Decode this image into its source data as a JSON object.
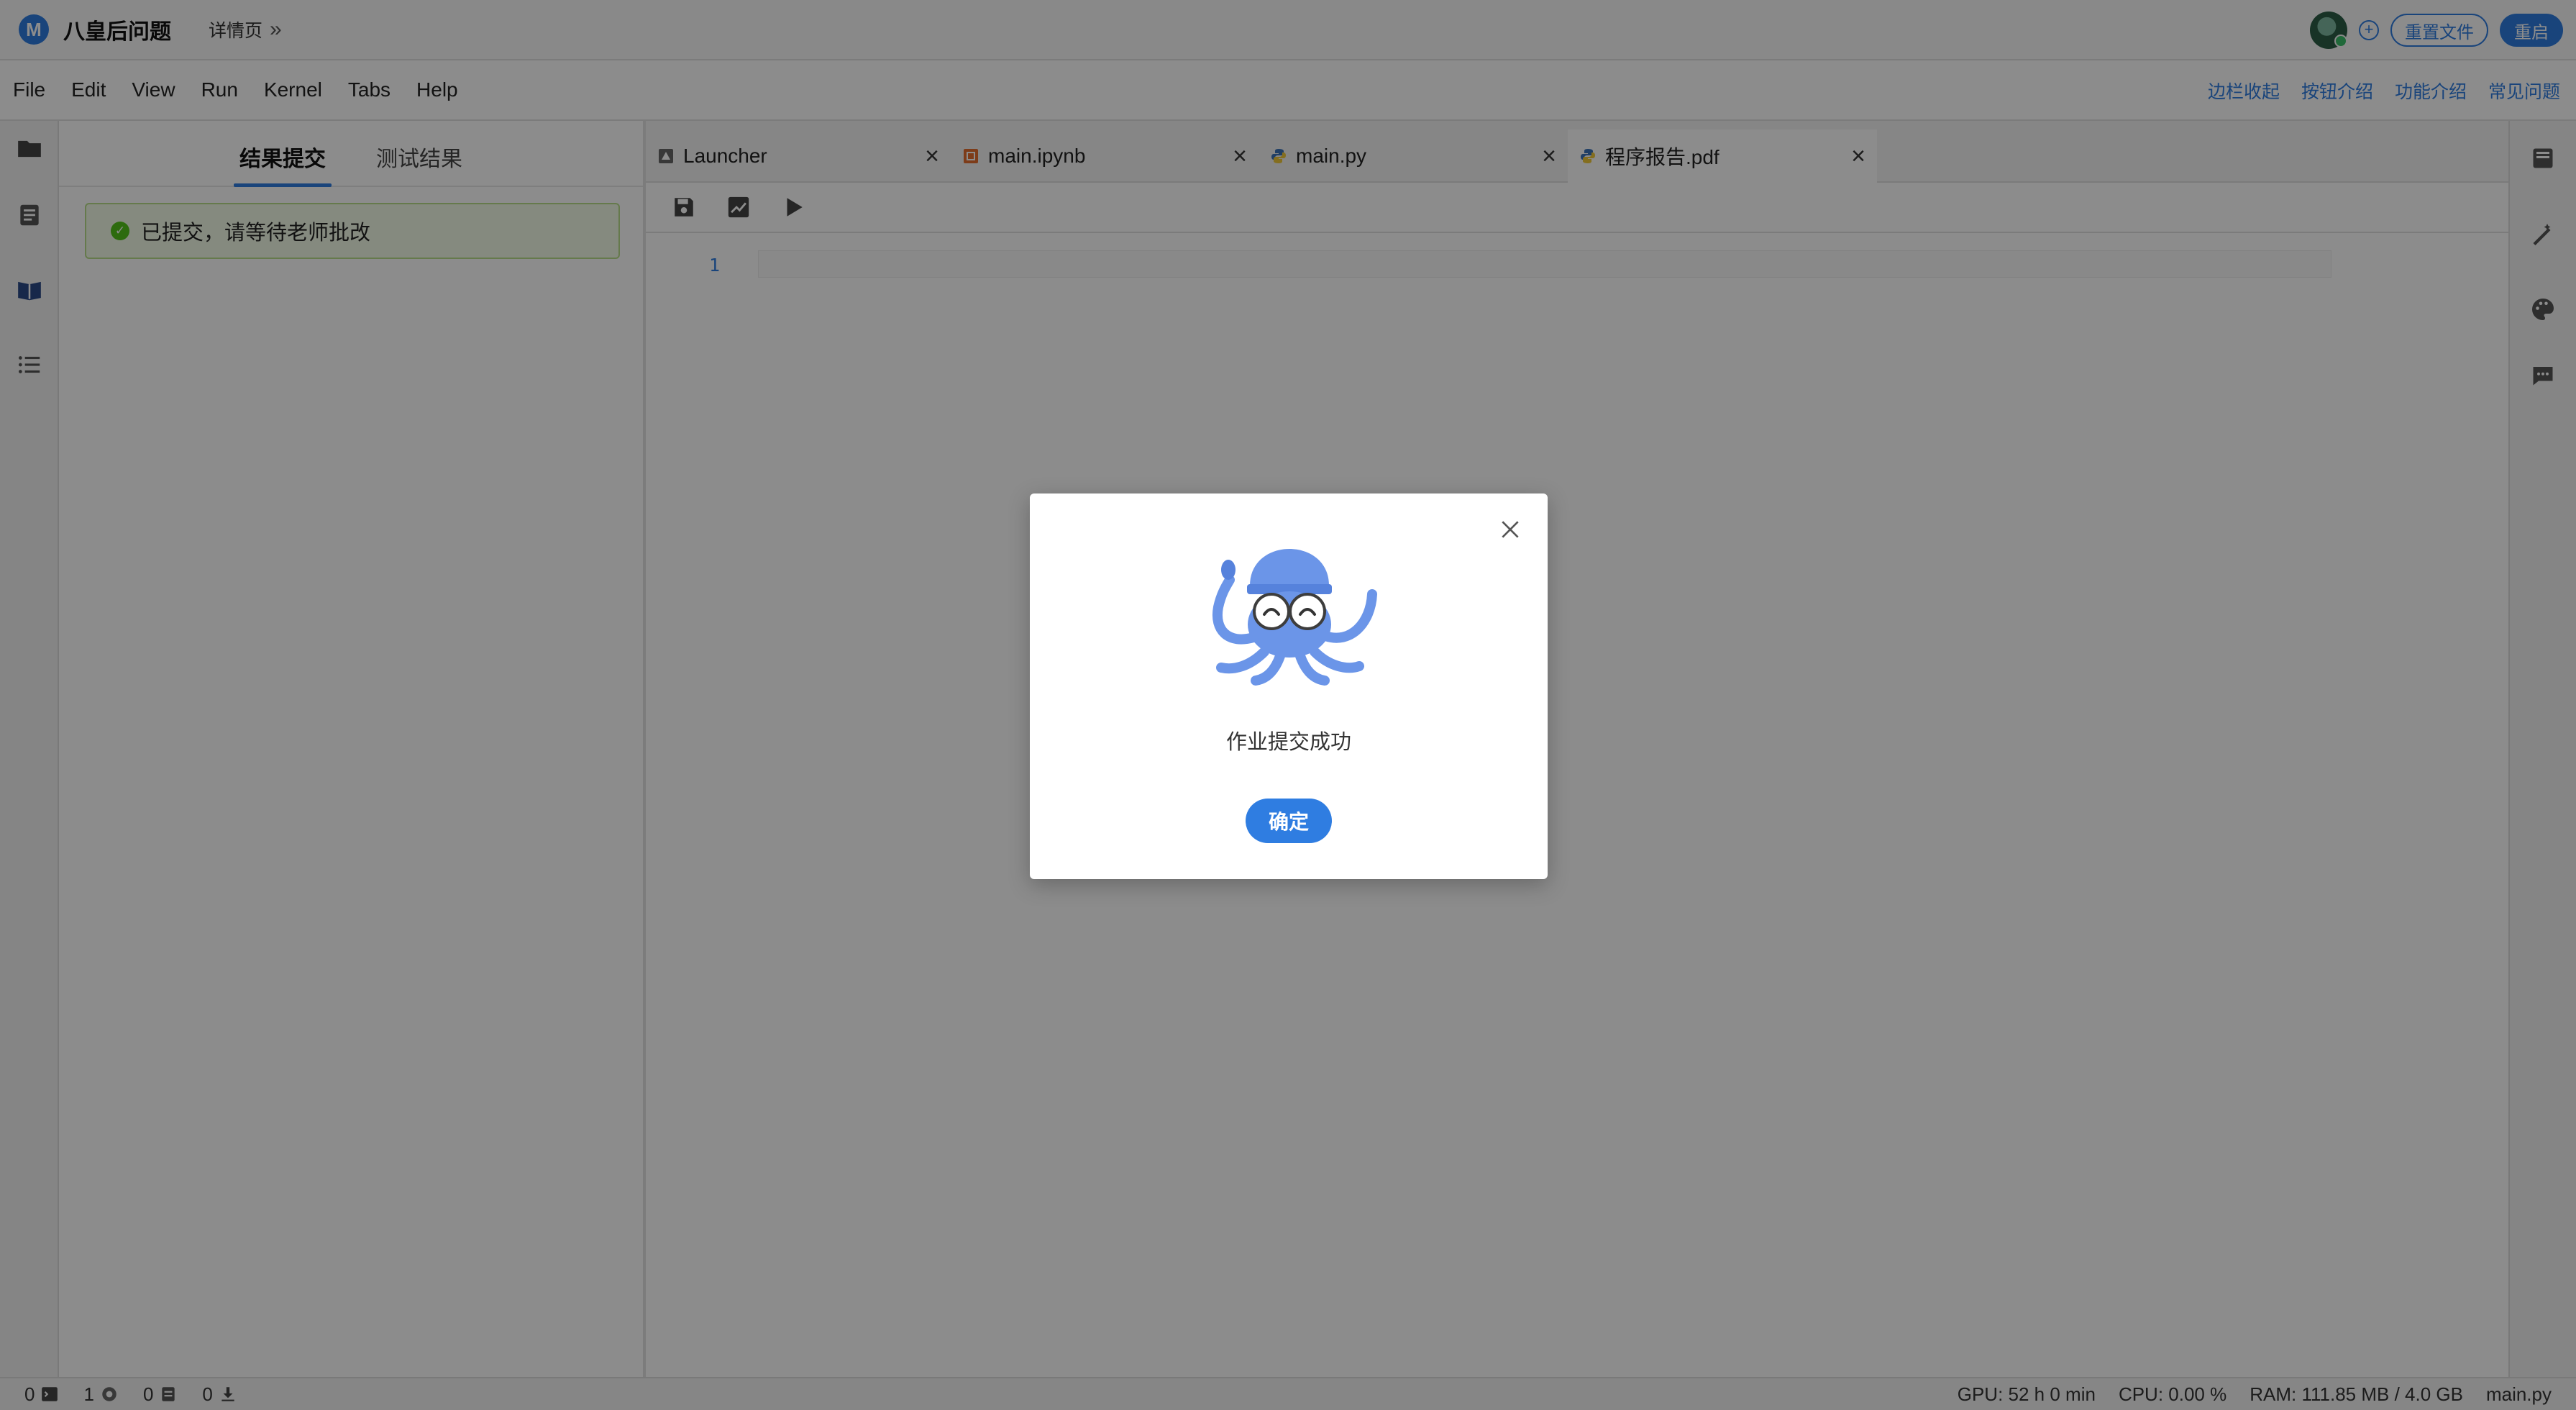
{
  "header": {
    "logo_letter": "M",
    "title": "八皇后问题",
    "breadcrumb": "详情页",
    "reset_button": "重置文件",
    "restart_button": "重启"
  },
  "menu": {
    "items": [
      "File",
      "Edit",
      "View",
      "Run",
      "Kernel",
      "Tabs",
      "Help"
    ],
    "links": [
      "边栏收起",
      "按钮介绍",
      "功能介绍",
      "常见问题"
    ]
  },
  "left_panel": {
    "tabs": [
      "结果提交",
      "测试结果"
    ],
    "active_tab": 0,
    "notice": "已提交，请等待老师批改"
  },
  "editor": {
    "tabs": [
      {
        "label": "Launcher",
        "icon": "launcher-icon"
      },
      {
        "label": "main.ipynb",
        "icon": "notebook-icon"
      },
      {
        "label": "main.py",
        "icon": "python-icon"
      },
      {
        "label": "程序报告.pdf",
        "icon": "python-icon"
      }
    ],
    "active_tab": 3,
    "line_number": "1"
  },
  "status": {
    "terminals": "0",
    "kernels": "1",
    "documents": "0",
    "downloads": "0",
    "gpu": "GPU: 52 h 0 min",
    "cpu": "CPU: 0.00 %",
    "ram": "RAM: 111.85 MB / 4.0 GB",
    "file": "main.py"
  },
  "modal": {
    "message": "作业提交成功",
    "ok_button": "确定"
  },
  "colors": {
    "accent": "#2f7de1",
    "success_bg": "#f3fbe8",
    "success_border": "#b9df8a",
    "mascot": "#6b95e8"
  }
}
